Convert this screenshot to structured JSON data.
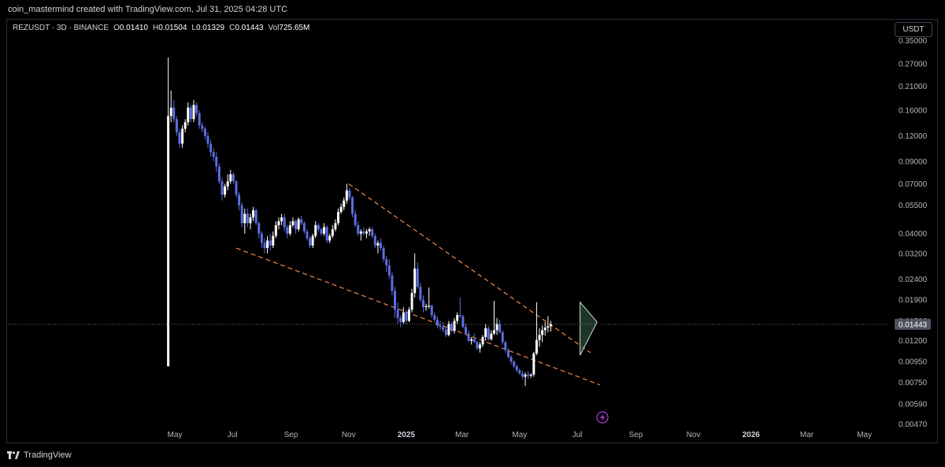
{
  "header": {
    "credit": "coin_mastermind created with TradingView.com, Jul 31, 2025 04:28 UTC"
  },
  "symbol": {
    "name": "REZUSDT · 3D · BINANCE",
    "open_label": "O",
    "open": "0.01410",
    "high_label": "H",
    "high": "0.01504",
    "low_label": "L",
    "low": "0.01329",
    "close_label": "C",
    "close": "0.01443",
    "vol_label": "Vol",
    "vol": "725.65M"
  },
  "currency": "USDT",
  "footer": {
    "brand": "TradingView"
  },
  "colors": {
    "background": "#000000",
    "up_candle": "#ffffff",
    "down_candle": "#5b6ee1",
    "trendline": "#f0874a",
    "triangle_fill": "#2e4a3a",
    "triangle_line": "#c8e6c9",
    "current_price_line": "#787b86",
    "lightning_icon": "#b03ae0"
  },
  "icons": {
    "lightning": "lightning-bolt-icon",
    "logo": "tradingview-logo-icon"
  },
  "chart_data": {
    "type": "candlestick",
    "scale": "log",
    "y_ticks": [
      "0.35000",
      "0.27000",
      "0.21000",
      "0.16000",
      "0.12000",
      "0.09000",
      "0.07000",
      "0.05500",
      "0.04000",
      "0.03200",
      "0.02400",
      "0.01900",
      "0.01500",
      "0.01200",
      "0.00950",
      "0.00750",
      "0.00590",
      "0.00470"
    ],
    "x_ticks": [
      {
        "label": "May",
        "date": "2024-05-01"
      },
      {
        "label": "Jul",
        "date": "2024-07-01"
      },
      {
        "label": "Sep",
        "date": "2024-09-01"
      },
      {
        "label": "Nov",
        "date": "2024-11-01"
      },
      {
        "label": "2025",
        "date": "2025-01-01",
        "bold": true
      },
      {
        "label": "Mar",
        "date": "2025-03-01"
      },
      {
        "label": "May",
        "date": "2025-05-01"
      },
      {
        "label": "Jul",
        "date": "2025-07-01"
      },
      {
        "label": "Sep",
        "date": "2025-09-01"
      },
      {
        "label": "Nov",
        "date": "2025-11-01"
      },
      {
        "label": "2026",
        "date": "2026-01-01",
        "bold": true
      },
      {
        "label": "Mar",
        "date": "2026-03-01"
      },
      {
        "label": "May",
        "date": "2026-05-01"
      }
    ],
    "last_price": "0.01443",
    "candles": [
      [
        "2024-04-24",
        0.009,
        0.29,
        0.009,
        0.15
      ],
      [
        "2024-04-27",
        0.15,
        0.2,
        0.14,
        0.165
      ],
      [
        "2024-04-30",
        0.165,
        0.18,
        0.14,
        0.145
      ],
      [
        "2024-05-03",
        0.145,
        0.15,
        0.12,
        0.125
      ],
      [
        "2024-05-06",
        0.125,
        0.13,
        0.105,
        0.11
      ],
      [
        "2024-05-09",
        0.11,
        0.135,
        0.105,
        0.13
      ],
      [
        "2024-05-12",
        0.13,
        0.145,
        0.125,
        0.14
      ],
      [
        "2024-05-15",
        0.14,
        0.175,
        0.135,
        0.165
      ],
      [
        "2024-05-18",
        0.165,
        0.17,
        0.14,
        0.145
      ],
      [
        "2024-05-21",
        0.145,
        0.18,
        0.14,
        0.17
      ],
      [
        "2024-05-24",
        0.17,
        0.175,
        0.15,
        0.155
      ],
      [
        "2024-05-27",
        0.155,
        0.16,
        0.13,
        0.135
      ],
      [
        "2024-05-30",
        0.135,
        0.14,
        0.125,
        0.13
      ],
      [
        "2024-06-02",
        0.13,
        0.133,
        0.115,
        0.12
      ],
      [
        "2024-06-05",
        0.12,
        0.125,
        0.105,
        0.11
      ],
      [
        "2024-06-08",
        0.11,
        0.115,
        0.095,
        0.1
      ],
      [
        "2024-06-11",
        0.1,
        0.105,
        0.09,
        0.095
      ],
      [
        "2024-06-14",
        0.095,
        0.1,
        0.08,
        0.085
      ],
      [
        "2024-06-17",
        0.085,
        0.088,
        0.07,
        0.072
      ],
      [
        "2024-06-20",
        0.072,
        0.075,
        0.058,
        0.062
      ],
      [
        "2024-06-23",
        0.062,
        0.07,
        0.06,
        0.068
      ],
      [
        "2024-06-26",
        0.068,
        0.078,
        0.065,
        0.072
      ],
      [
        "2024-06-29",
        0.072,
        0.082,
        0.07,
        0.078
      ],
      [
        "2024-07-02",
        0.078,
        0.08,
        0.07,
        0.072
      ],
      [
        "2024-07-05",
        0.072,
        0.073,
        0.06,
        0.062
      ],
      [
        "2024-07-08",
        0.062,
        0.064,
        0.052,
        0.055
      ],
      [
        "2024-07-11",
        0.055,
        0.057,
        0.043,
        0.045
      ],
      [
        "2024-07-14",
        0.045,
        0.053,
        0.04,
        0.05
      ],
      [
        "2024-07-17",
        0.05,
        0.053,
        0.043,
        0.045
      ],
      [
        "2024-07-20",
        0.045,
        0.05,
        0.042,
        0.048
      ],
      [
        "2024-07-23",
        0.048,
        0.054,
        0.046,
        0.052
      ],
      [
        "2024-07-26",
        0.052,
        0.053,
        0.044,
        0.045
      ],
      [
        "2024-07-29",
        0.045,
        0.046,
        0.038,
        0.04
      ],
      [
        "2024-08-01",
        0.04,
        0.041,
        0.034,
        0.036
      ],
      [
        "2024-08-04",
        0.036,
        0.038,
        0.032,
        0.034
      ],
      [
        "2024-08-07",
        0.034,
        0.039,
        0.032,
        0.037
      ],
      [
        "2024-08-10",
        0.037,
        0.04,
        0.033,
        0.035
      ],
      [
        "2024-08-13",
        0.035,
        0.041,
        0.034,
        0.039
      ],
      [
        "2024-08-16",
        0.039,
        0.046,
        0.038,
        0.044
      ],
      [
        "2024-08-19",
        0.044,
        0.048,
        0.042,
        0.046
      ],
      [
        "2024-08-22",
        0.046,
        0.05,
        0.044,
        0.048
      ],
      [
        "2024-08-25",
        0.048,
        0.05,
        0.041,
        0.043
      ],
      [
        "2024-08-28",
        0.043,
        0.044,
        0.038,
        0.04
      ],
      [
        "2024-08-31",
        0.04,
        0.046,
        0.039,
        0.044
      ],
      [
        "2024-09-03",
        0.044,
        0.048,
        0.043,
        0.046
      ],
      [
        "2024-09-06",
        0.046,
        0.047,
        0.04,
        0.042
      ],
      [
        "2024-09-09",
        0.042,
        0.048,
        0.041,
        0.047
      ],
      [
        "2024-09-12",
        0.047,
        0.049,
        0.044,
        0.045
      ],
      [
        "2024-09-15",
        0.045,
        0.046,
        0.04,
        0.041
      ],
      [
        "2024-09-18",
        0.041,
        0.042,
        0.037,
        0.038
      ],
      [
        "2024-09-21",
        0.038,
        0.039,
        0.034,
        0.035
      ],
      [
        "2024-09-24",
        0.035,
        0.04,
        0.034,
        0.039
      ],
      [
        "2024-09-27",
        0.039,
        0.046,
        0.038,
        0.044
      ],
      [
        "2024-09-30",
        0.044,
        0.045,
        0.041,
        0.042
      ],
      [
        "2024-10-03",
        0.042,
        0.043,
        0.039,
        0.04
      ],
      [
        "2024-10-06",
        0.04,
        0.045,
        0.039,
        0.043
      ],
      [
        "2024-10-09",
        0.043,
        0.044,
        0.036,
        0.037
      ],
      [
        "2024-10-12",
        0.037,
        0.04,
        0.036,
        0.039
      ],
      [
        "2024-10-15",
        0.039,
        0.044,
        0.038,
        0.042
      ],
      [
        "2024-10-18",
        0.042,
        0.047,
        0.041,
        0.045
      ],
      [
        "2024-10-21",
        0.045,
        0.053,
        0.044,
        0.051
      ],
      [
        "2024-10-24",
        0.051,
        0.056,
        0.05,
        0.054
      ],
      [
        "2024-10-27",
        0.054,
        0.06,
        0.052,
        0.058
      ],
      [
        "2024-10-30",
        0.058,
        0.07,
        0.056,
        0.065
      ],
      [
        "2024-11-02",
        0.065,
        0.067,
        0.058,
        0.06
      ],
      [
        "2024-11-05",
        0.06,
        0.061,
        0.048,
        0.05
      ],
      [
        "2024-11-08",
        0.05,
        0.052,
        0.043,
        0.044
      ],
      [
        "2024-11-11",
        0.044,
        0.046,
        0.039,
        0.04
      ],
      [
        "2024-11-14",
        0.04,
        0.042,
        0.037,
        0.041
      ],
      [
        "2024-11-17",
        0.041,
        0.043,
        0.039,
        0.04
      ],
      [
        "2024-11-20",
        0.04,
        0.042,
        0.038,
        0.041
      ],
      [
        "2024-11-23",
        0.041,
        0.043,
        0.039,
        0.042
      ],
      [
        "2024-11-26",
        0.042,
        0.043,
        0.038,
        0.039
      ],
      [
        "2024-11-29",
        0.039,
        0.04,
        0.034,
        0.035
      ],
      [
        "2024-12-02",
        0.035,
        0.037,
        0.032,
        0.036
      ],
      [
        "2024-12-05",
        0.036,
        0.038,
        0.033,
        0.034
      ],
      [
        "2024-12-08",
        0.034,
        0.035,
        0.029,
        0.03
      ],
      [
        "2024-12-11",
        0.03,
        0.031,
        0.026,
        0.028
      ],
      [
        "2024-12-14",
        0.028,
        0.03,
        0.024,
        0.025
      ],
      [
        "2024-12-17",
        0.025,
        0.026,
        0.02,
        0.021
      ],
      [
        "2024-12-20",
        0.021,
        0.022,
        0.0155,
        0.017
      ],
      [
        "2024-12-23",
        0.017,
        0.0185,
        0.0145,
        0.0155
      ],
      [
        "2024-12-26",
        0.0155,
        0.016,
        0.014,
        0.0148
      ],
      [
        "2024-12-29",
        0.0148,
        0.0175,
        0.0145,
        0.0165
      ],
      [
        "2025-01-01",
        0.0165,
        0.017,
        0.0145,
        0.015
      ],
      [
        "2025-01-04",
        0.015,
        0.0175,
        0.0148,
        0.017
      ],
      [
        "2025-01-07",
        0.017,
        0.0215,
        0.0165,
        0.0205
      ],
      [
        "2025-01-10",
        0.0205,
        0.032,
        0.0195,
        0.027
      ],
      [
        "2025-01-13",
        0.027,
        0.029,
        0.0215,
        0.022
      ],
      [
        "2025-01-16",
        0.022,
        0.023,
        0.0185,
        0.019
      ],
      [
        "2025-01-19",
        0.019,
        0.02,
        0.0165,
        0.0175
      ],
      [
        "2025-01-22",
        0.0175,
        0.0182,
        0.0168,
        0.0177
      ],
      [
        "2025-01-25",
        0.0177,
        0.0218,
        0.0172,
        0.0178
      ],
      [
        "2025-01-28",
        0.0178,
        0.018,
        0.0155,
        0.016
      ],
      [
        "2025-01-31",
        0.016,
        0.0165,
        0.0148,
        0.0152
      ],
      [
        "2025-02-03",
        0.0152,
        0.0158,
        0.0138,
        0.0142
      ],
      [
        "2025-02-06",
        0.0142,
        0.015,
        0.0135,
        0.014
      ],
      [
        "2025-02-09",
        0.014,
        0.0148,
        0.0132,
        0.0136
      ],
      [
        "2025-02-12",
        0.0136,
        0.014,
        0.0125,
        0.0128
      ],
      [
        "2025-02-15",
        0.0128,
        0.015,
        0.0126,
        0.0145
      ],
      [
        "2025-02-18",
        0.0145,
        0.0148,
        0.0132,
        0.0134
      ],
      [
        "2025-02-21",
        0.0134,
        0.0155,
        0.013,
        0.015
      ],
      [
        "2025-02-24",
        0.015,
        0.0165,
        0.0145,
        0.016
      ],
      [
        "2025-02-27",
        0.016,
        0.0195,
        0.0155,
        0.0158
      ],
      [
        "2025-03-02",
        0.0158,
        0.016,
        0.0138,
        0.014
      ],
      [
        "2025-03-05",
        0.014,
        0.0145,
        0.0128,
        0.013
      ],
      [
        "2025-03-08",
        0.013,
        0.0135,
        0.0118,
        0.012
      ],
      [
        "2025-03-11",
        0.012,
        0.0125,
        0.0115,
        0.0122
      ],
      [
        "2025-03-14",
        0.0122,
        0.013,
        0.0117,
        0.0118
      ],
      [
        "2025-03-17",
        0.0118,
        0.012,
        0.0108,
        0.011
      ],
      [
        "2025-03-20",
        0.011,
        0.0118,
        0.0105,
        0.0115
      ],
      [
        "2025-03-23",
        0.0115,
        0.0128,
        0.0112,
        0.0125
      ],
      [
        "2025-03-26",
        0.0125,
        0.0145,
        0.012,
        0.0138
      ],
      [
        "2025-03-29",
        0.0138,
        0.0142,
        0.012,
        0.0122
      ],
      [
        "2025-04-01",
        0.0122,
        0.0135,
        0.012,
        0.013
      ],
      [
        "2025-04-04",
        0.013,
        0.0188,
        0.0128,
        0.0135
      ],
      [
        "2025-04-07",
        0.0135,
        0.0155,
        0.0128,
        0.0145
      ],
      [
        "2025-04-10",
        0.0145,
        0.0152,
        0.013,
        0.0132
      ],
      [
        "2025-04-13",
        0.0132,
        0.0135,
        0.0115,
        0.0118
      ],
      [
        "2025-04-16",
        0.0118,
        0.012,
        0.0105,
        0.0108
      ],
      [
        "2025-04-19",
        0.0108,
        0.011,
        0.0098,
        0.01
      ],
      [
        "2025-04-22",
        0.01,
        0.0102,
        0.0092,
        0.0095
      ],
      [
        "2025-04-25",
        0.0095,
        0.0096,
        0.0088,
        0.009
      ],
      [
        "2025-04-28",
        0.009,
        0.0092,
        0.0084,
        0.0086
      ],
      [
        "2025-05-01",
        0.0086,
        0.0088,
        0.0082,
        0.0083
      ],
      [
        "2025-05-04",
        0.0083,
        0.0086,
        0.0078,
        0.008
      ],
      [
        "2025-05-07",
        0.008,
        0.0084,
        0.0072,
        0.0082
      ],
      [
        "2025-05-10",
        0.0082,
        0.0085,
        0.0078,
        0.0081
      ],
      [
        "2025-05-13",
        0.0081,
        0.0083,
        0.0079,
        0.0082
      ],
      [
        "2025-05-16",
        0.0082,
        0.0106,
        0.008,
        0.0104
      ],
      [
        "2025-05-19",
        0.0104,
        0.0185,
        0.0102,
        0.0121
      ],
      [
        "2025-05-22",
        0.0121,
        0.0138,
        0.0112,
        0.0128
      ],
      [
        "2025-05-25",
        0.0128,
        0.0142,
        0.0118,
        0.0135
      ],
      [
        "2025-05-28",
        0.0135,
        0.0148,
        0.0127,
        0.0139
      ],
      [
        "2025-05-31",
        0.0139,
        0.0158,
        0.0132,
        0.0141
      ],
      [
        "2025-06-03",
        0.0141,
        0.015,
        0.0133,
        0.0144
      ]
    ],
    "trendlines": [
      {
        "name": "upper-wedge-line",
        "from": [
          "2024-11-01",
          0.07
        ],
        "to": [
          "2025-07-15",
          0.0105
        ],
        "style": "dashed"
      },
      {
        "name": "lower-wedge-line",
        "from": [
          "2024-07-05",
          0.034
        ],
        "to": [
          "2025-07-25",
          0.0073
        ],
        "style": "dashed"
      }
    ],
    "triangle": {
      "points": [
        [
          "2025-07-04",
          0.0185
        ],
        [
          "2025-07-04",
          0.0102
        ],
        [
          "2025-07-22",
          0.0148
        ]
      ]
    }
  }
}
